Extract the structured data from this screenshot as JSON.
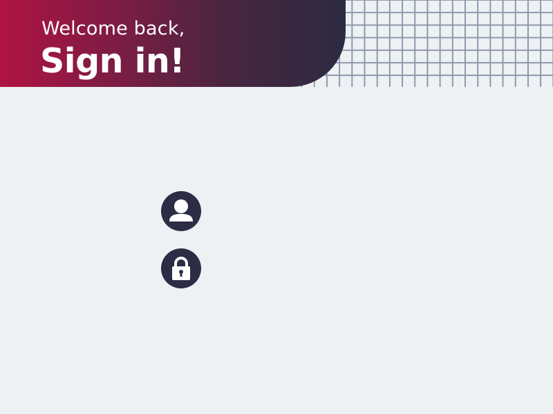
{
  "header": {
    "welcome": "Welcome back,",
    "title": "Sign in!"
  },
  "form": {
    "username": {
      "value": "",
      "placeholder": "",
      "icon": "user-icon"
    },
    "password": {
      "value": "",
      "placeholder": "",
      "icon": "lock-icon"
    }
  },
  "colors": {
    "background": "#edf1f4",
    "accent_start": "#b01342",
    "accent_end": "#2b2b42",
    "icon": "#2b2d45",
    "grid_line": "#8e97aa"
  }
}
